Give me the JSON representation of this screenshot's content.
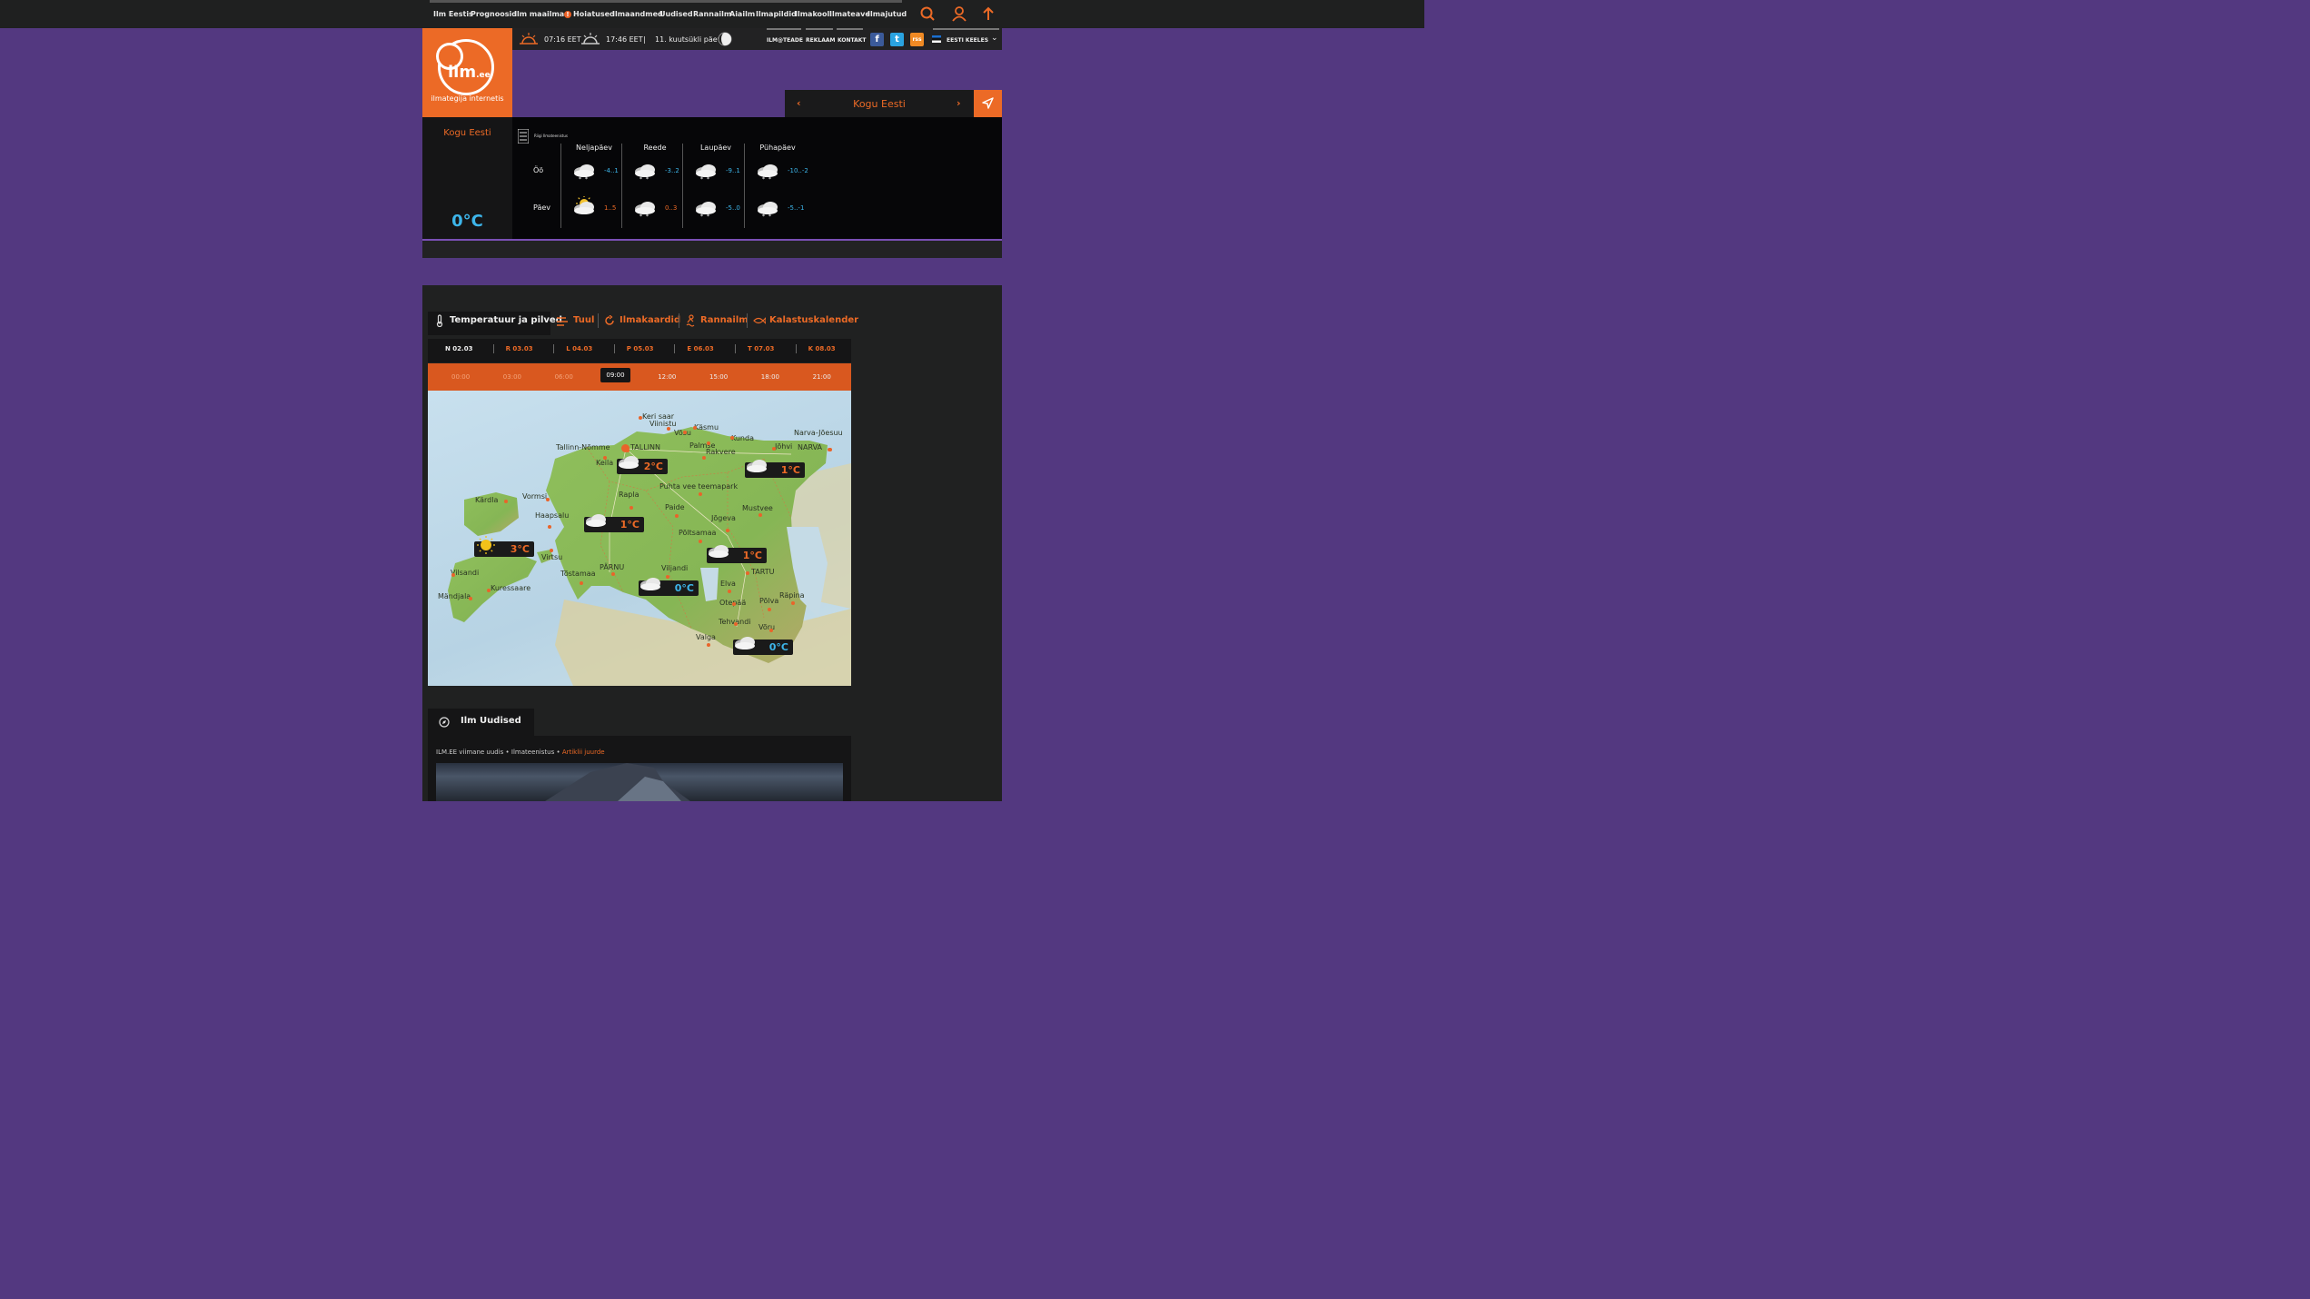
{
  "nav": {
    "items": [
      "Ilm Eestis",
      "Prognoosid",
      "Ilm maailmas",
      "Hoiatused",
      "Ilmaandmed",
      "Uudised",
      "Rannailm",
      "Aiailm",
      "Ilmapildid",
      "Ilmakool",
      "Ilmateave",
      "Ilmajutud"
    ],
    "warning_mark": "!"
  },
  "logo": {
    "main": "ilm",
    "suffix": ".ee",
    "tagline": "ilmategija internetis"
  },
  "infobar": {
    "sunrise": "07:16 EET",
    "sunset": "17:46 EET",
    "separator": "|",
    "moon_day": "11. kuutsükli päev",
    "links": [
      "ILM@TEADE",
      "REKLAAM",
      "KONTAKT"
    ],
    "social": [
      "f",
      "t",
      "rss"
    ],
    "language": "EESTI KEELES"
  },
  "location_nav": {
    "prev": "‹",
    "name": "Kogu Eesti",
    "next": "›"
  },
  "current": {
    "location": "Kogu Eesti",
    "temperature": "0°C"
  },
  "forecast": {
    "provider": "Riigi Ilmateenistus",
    "row_labels": [
      "Öö",
      "Päev"
    ],
    "days": [
      {
        "name": "Neljapäev",
        "night": "-4..1",
        "day": "1..5",
        "day_icon": "sun-cloud"
      },
      {
        "name": "Reede",
        "night": "-3..2",
        "day": "0..3",
        "day_icon": "cloud-snow"
      },
      {
        "name": "Laupäev",
        "night": "-9..1",
        "day": "-5..0",
        "day_icon": "cloud-snow"
      },
      {
        "name": "Pühapäev",
        "night": "-10..-2",
        "day": "-5..-1",
        "day_icon": "cloud-snow"
      }
    ]
  },
  "tabs": [
    "Temperatuur ja pilved",
    "Tuul",
    "Ilmakaardid",
    "Rannailm",
    "Kalastuskalender"
  ],
  "dates": [
    "N 02.03",
    "R 03.03",
    "L 04.03",
    "P 05.03",
    "E 06.03",
    "T 07.03",
    "K 08.03"
  ],
  "times": [
    "00:00",
    "03:00",
    "06:00",
    "09:00",
    "12:00",
    "15:00",
    "18:00",
    "21:00"
  ],
  "selected_time": "09:00",
  "map": {
    "places": [
      "Keri saar",
      "Viinistu",
      "Käsmu",
      "Võsu",
      "Kunda",
      "Narva-Jõesuu",
      "Tallinn-Nõmme",
      "TALLINN",
      "Palmse",
      "Rakvere",
      "Jõhvi",
      "NARVA",
      "Keila",
      "Kärdla",
      "Vormsi",
      "Rapla",
      "Puhta vee teemapark",
      "Haapsalu",
      "Paide",
      "Mustvee",
      "Jõgeva",
      "Põltsamaa",
      "Virtsu",
      "Viljandi",
      "PÄRNU",
      "Tõstamaa",
      "TARTU",
      "Vilsandi",
      "Kuressaare",
      "Mändjala",
      "Elva",
      "Otepää",
      "Põlva",
      "Räpina",
      "Tehvandi",
      "Võru",
      "Valga"
    ],
    "temps": [
      "2°C",
      "1°C",
      "1°C",
      "3°C",
      "1°C",
      "0°C",
      "0°C"
    ]
  },
  "news": {
    "title": "Ilm Uudised",
    "meta": "ILM.EE viimane uudis • Ilmateenistus • ",
    "link": "Artiklii juurde"
  },
  "colors": {
    "accent": "#ec6a26",
    "background": "#533880",
    "cold": "#3db5ea"
  }
}
